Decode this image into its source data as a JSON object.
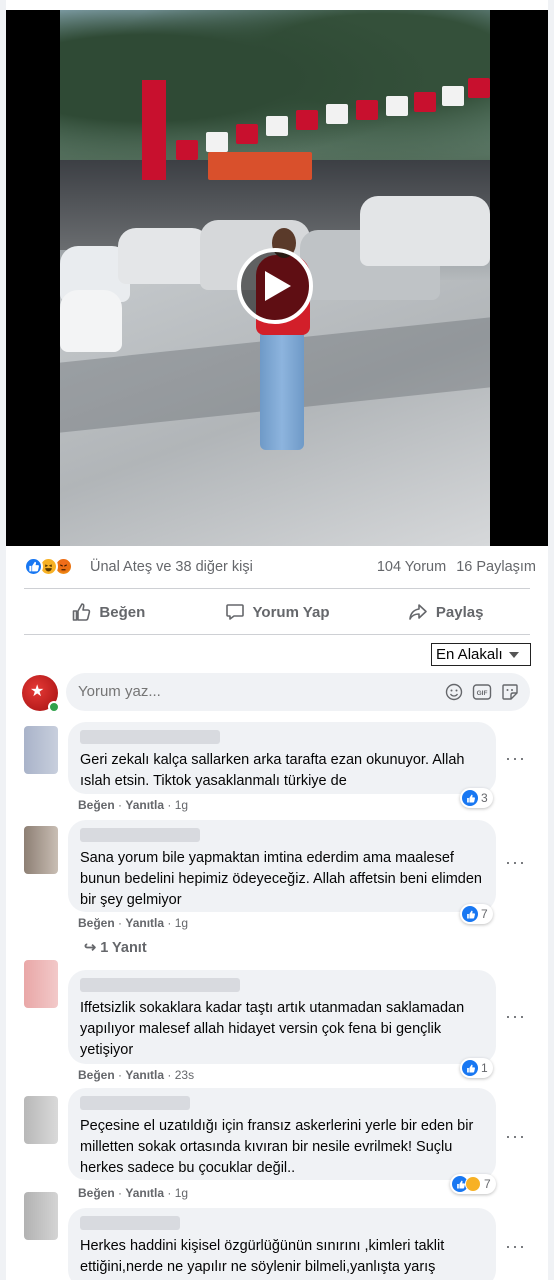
{
  "post": {
    "reactions_text": "Ünal Ateş ve 38 diğer kişi",
    "comments_count": "104 Yorum",
    "shares_count": "16 Paylaşım",
    "reaction_types": [
      "like",
      "haha",
      "angry"
    ]
  },
  "actions": {
    "like": "Beğen",
    "comment": "Yorum Yap",
    "share": "Paylaş"
  },
  "sort": {
    "label": "En Alakalı"
  },
  "composer": {
    "placeholder": "Yorum yaz..."
  },
  "comments": [
    {
      "text": "Geri zekalı kalça sallarken arka tarafta ezan okunuyor. Allah ıslah etsin. Tiktok yasaklanmalı türkiye de",
      "like": "Beğen",
      "reply": "Yanıtla",
      "time": "1g",
      "reaction_count": "3"
    },
    {
      "text": "Sana yorum bile yapmaktan imtina ederdim ama maalesef bunun bedelini hepimiz ödeyeceğiz. Allah affetsin beni elimden bir şey gelmiyor",
      "like": "Beğen",
      "reply": "Yanıtla",
      "time": "1g",
      "reaction_count": "7",
      "replies_label": "1 Yanıt"
    },
    {
      "text": "Iffetsizlik sokaklara kadar taştı artık utanmadan saklamadan yapılıyor malesef allah hidayet versin çok fena bi gençlik yetişiyor",
      "like": "Beğen",
      "reply": "Yanıtla",
      "time": "23s",
      "reaction_count": "1"
    },
    {
      "text": "Peçesine el uzatıldığı için fransız askerlerini yerle bir eden bir milletten sokak ortasında kıvıran bir nesile evrilmek! Suçlu herkes sadece bu çocuklar değil..",
      "like": "Beğen",
      "reply": "Yanıtla",
      "time": "1g",
      "reaction_count": "7"
    },
    {
      "text": "Herkes haddini kişisel özgürlüğünün sınırını ,kimleri taklit ettiğini,nerde ne yapılır ne söylenir bilmeli,yanlışta yarış"
    }
  ],
  "colors": {
    "accent": "#1877f2",
    "bubble": "#f0f2f5",
    "muted": "#65676b",
    "online": "#31a24c"
  }
}
